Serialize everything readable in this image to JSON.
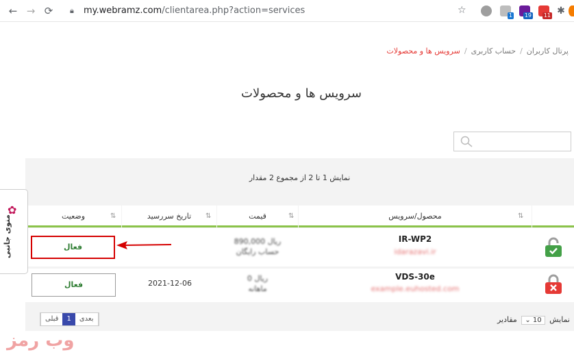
{
  "browser": {
    "url_host": "my.webramz.com",
    "url_path": "/clientarea.php?action=services",
    "ext_badges": [
      "1",
      "19",
      "11"
    ]
  },
  "breadcrumb": {
    "items": [
      "پرتال کاربران",
      "حساب کاربری",
      "سرویس ها و محصولات"
    ]
  },
  "page": {
    "title": "سرویس ها و محصولات",
    "count_text": "نمایش 1 تا 2 از مجموع 2 مقدار"
  },
  "table": {
    "headers": {
      "product": "محصول/سرویس",
      "price": "قیمت",
      "due_date": "تاریخ سررسید",
      "status": "وضعیت"
    },
    "rows": [
      {
        "name": "IR-WP2",
        "domain": "idarazavi.ir",
        "price": "890,000 ریال",
        "cycle": "حساب رایگان",
        "due_date": "",
        "status": "فعال"
      },
      {
        "name": "VDS-30e",
        "domain": "example.euhosted.com",
        "price": "0 ریال",
        "cycle": "ماهانه",
        "due_date": "2021-12-06",
        "status": "فعال"
      }
    ]
  },
  "pagination": {
    "next": "بعدی",
    "current": "1",
    "prev": "قبلی",
    "show_label": "نمایش",
    "per_page": "10",
    "items_label": "مقادیر"
  },
  "sidebar": {
    "label": "منوی جانبی"
  },
  "watermark": "وب رمز",
  "colors": {
    "accent_green": "#8bc34a",
    "active_red": "#e53935",
    "status_green": "#2e7d32"
  }
}
